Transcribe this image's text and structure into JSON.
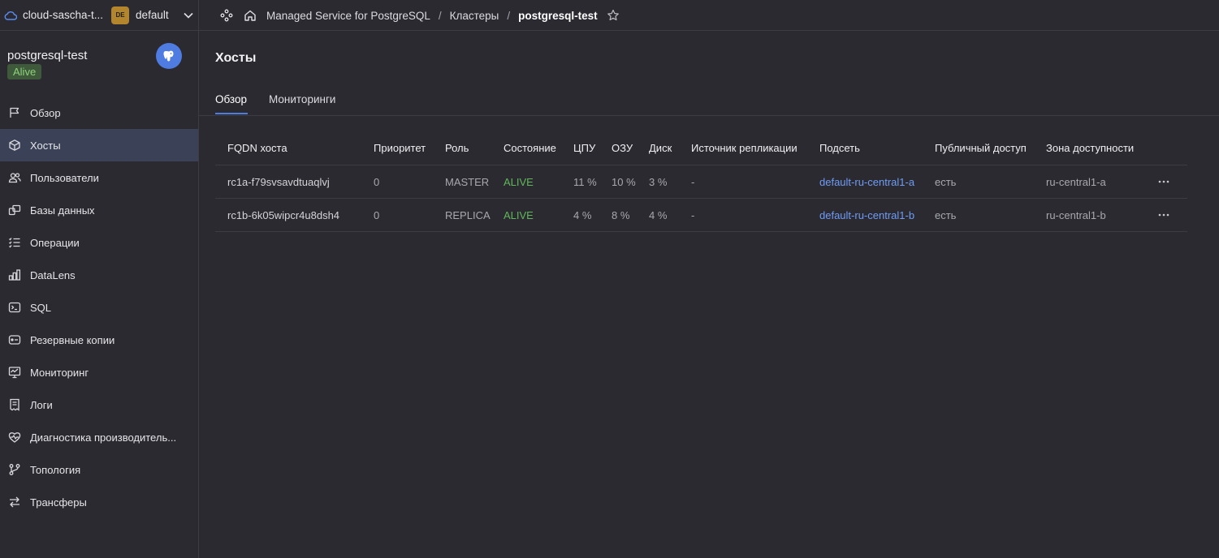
{
  "topbar": {
    "cloud_name": "cloud-sascha-t...",
    "folder_badge": "DE",
    "folder_name": "default",
    "breadcrumbs": [
      "Managed Service for PostgreSQL",
      "Кластеры",
      "postgresql-test"
    ],
    "separator": "/"
  },
  "sidebar": {
    "cluster_name": "postgresql-test",
    "status": "Alive",
    "items": [
      {
        "label": "Обзор",
        "icon": "flag-icon"
      },
      {
        "label": "Хосты",
        "icon": "cube-icon",
        "active": true
      },
      {
        "label": "Пользователи",
        "icon": "users-icon"
      },
      {
        "label": "Базы данных",
        "icon": "databases-icon"
      },
      {
        "label": "Операции",
        "icon": "list-icon"
      },
      {
        "label": "DataLens",
        "icon": "chart-icon"
      },
      {
        "label": "SQL",
        "icon": "terminal-icon"
      },
      {
        "label": "Резервные копии",
        "icon": "backup-icon"
      },
      {
        "label": "Мониторинг",
        "icon": "monitor-icon"
      },
      {
        "label": "Логи",
        "icon": "logs-icon"
      },
      {
        "label": "Диагностика производитель...",
        "icon": "heartbeat-icon"
      },
      {
        "label": "Топология",
        "icon": "topology-icon"
      },
      {
        "label": "Трансферы",
        "icon": "transfer-icon"
      }
    ]
  },
  "main": {
    "title": "Хосты",
    "tabs": [
      {
        "label": "Обзор",
        "active": true
      },
      {
        "label": "Мониторинги"
      }
    ],
    "table": {
      "columns": [
        "FQDN хоста",
        "Приоритет",
        "Роль",
        "Состояние",
        "ЦПУ",
        "ОЗУ",
        "Диск",
        "Источник репликации",
        "Подсеть",
        "Публичный доступ",
        "Зона доступности"
      ],
      "rows": [
        [
          "rc1a-f79svsavdtuaqlvj",
          "0",
          "MASTER",
          "ALIVE",
          "11 %",
          "10 %",
          "3 %",
          "-",
          "default-ru-central1-a",
          "есть",
          "ru-central1-a"
        ],
        [
          "rc1b-6k05wipcr4u8dsh4",
          "0",
          "REPLICA",
          "ALIVE",
          "4 %",
          "8 %",
          "4 %",
          "-",
          "default-ru-central1-b",
          "есть",
          "ru-central1-b"
        ]
      ]
    }
  },
  "colors": {
    "background": "#2b2a30",
    "accent": "#4f7ce0",
    "alive": "#5fb75a",
    "link": "#6f9cf4",
    "folder_badge": "#b3852c"
  }
}
